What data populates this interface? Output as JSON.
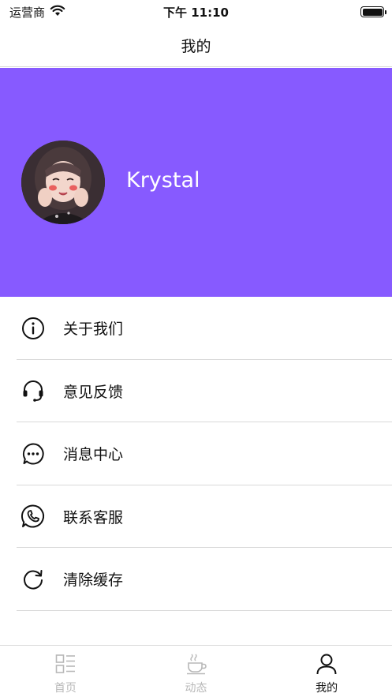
{
  "status_bar": {
    "carrier": "运营商",
    "time": "下午 11:10",
    "wifi_icon": "wifi-icon",
    "battery_icon": "battery-icon"
  },
  "nav": {
    "title": "我的"
  },
  "profile": {
    "username": "Krystal",
    "header_color": "#875aff",
    "avatar_icon": "avatar-photo"
  },
  "menu": {
    "items": [
      {
        "label": "关于我们",
        "icon": "info-icon"
      },
      {
        "label": "意见反馈",
        "icon": "headset-icon"
      },
      {
        "label": "消息中心",
        "icon": "message-icon"
      },
      {
        "label": "联系客服",
        "icon": "phone-icon"
      },
      {
        "label": "清除缓存",
        "icon": "refresh-icon"
      }
    ]
  },
  "tab_bar": {
    "tabs": [
      {
        "label": "首页",
        "icon": "home-grid-icon",
        "active": false
      },
      {
        "label": "动态",
        "icon": "coffee-icon",
        "active": false
      },
      {
        "label": "我的",
        "icon": "person-icon",
        "active": true
      }
    ]
  },
  "colors": {
    "accent": "#875aff",
    "tab_inactive": "#b8b8b8",
    "tab_active": "#111111"
  }
}
